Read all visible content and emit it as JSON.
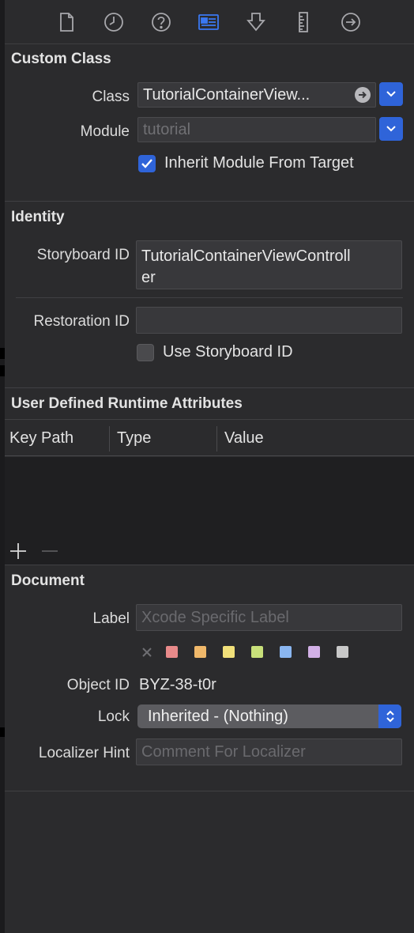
{
  "toolbar": {
    "icons": [
      "file-inspector-icon",
      "history-inspector-icon",
      "quick-help-icon",
      "identity-inspector-icon",
      "attributes-inspector-icon",
      "size-inspector-icon",
      "connections-inspector-icon"
    ]
  },
  "custom_class": {
    "title": "Custom Class",
    "class_label": "Class",
    "class_value": "TutorialContainerView...",
    "module_label": "Module",
    "module_placeholder": "tutorial",
    "inherit_label": "Inherit Module From Target",
    "inherit_checked": true
  },
  "identity": {
    "title": "Identity",
    "storyboard_id_label": "Storyboard ID",
    "storyboard_id_line1": "TutorialContainerViewControll",
    "storyboard_id_line2": "er",
    "restoration_id_label": "Restoration ID",
    "restoration_id_value": "",
    "use_storyboard_label": "Use Storyboard ID",
    "use_storyboard_checked": false
  },
  "runtime_attributes": {
    "title": "User Defined Runtime Attributes",
    "columns": [
      "Key Path",
      "Type",
      "Value"
    ],
    "rows": []
  },
  "document": {
    "title": "Document",
    "label_label": "Label",
    "label_placeholder": "Xcode Specific Label",
    "swatch_colors": [
      "#e88a8a",
      "#f0b86a",
      "#f1e07a",
      "#c8e07a",
      "#8ab6f0",
      "#d2b0e6",
      "#c8c8c8"
    ],
    "object_id_label": "Object ID",
    "object_id_value": "BYZ-38-t0r",
    "lock_label": "Lock",
    "lock_value": "Inherited - (Nothing)",
    "localizer_hint_label": "Localizer Hint",
    "localizer_hint_placeholder": "Comment For Localizer"
  },
  "colors": {
    "accent": "#2f64d9",
    "panel_bg": "#2b2b2d"
  }
}
